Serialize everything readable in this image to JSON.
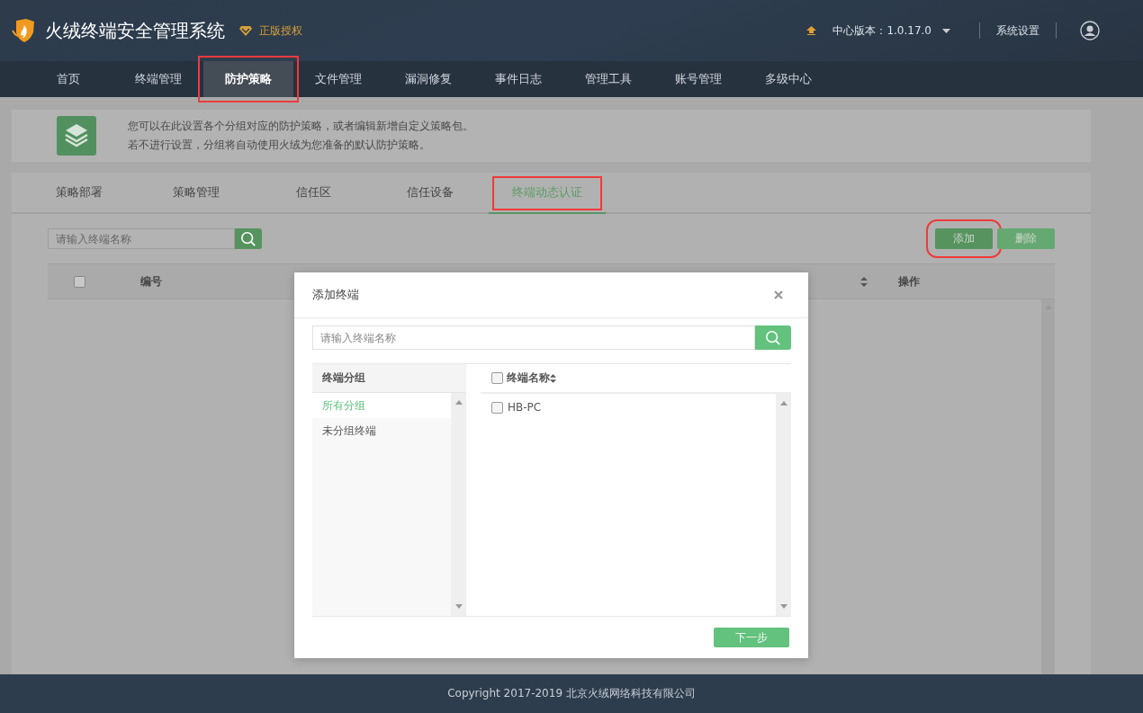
{
  "header": {
    "title": "火绒终端安全管理系统",
    "license": "正版授权",
    "version": "中心版本：1.0.17.0",
    "settings": "系统设置"
  },
  "nav": [
    {
      "label": "首页",
      "selected": false,
      "highlighted": false
    },
    {
      "label": "终端管理",
      "selected": false,
      "highlighted": false
    },
    {
      "label": "防护策略",
      "selected": true,
      "highlighted": true
    },
    {
      "label": "文件管理",
      "selected": false,
      "highlighted": false
    },
    {
      "label": "漏洞修复",
      "selected": false,
      "highlighted": false
    },
    {
      "label": "事件日志",
      "selected": false,
      "highlighted": false
    },
    {
      "label": "管理工具",
      "selected": false,
      "highlighted": false
    },
    {
      "label": "账号管理",
      "selected": false,
      "highlighted": false
    },
    {
      "label": "多级中心",
      "selected": false,
      "highlighted": false
    }
  ],
  "info": {
    "lines": [
      "您可以在此设置各个分组对应的防护策略，或者编辑新增自定义策略包。",
      "若不进行设置，分组将自动使用火绒为您准备的默认防护策略。"
    ]
  },
  "tabs": [
    {
      "label": "策略部署",
      "selected": false,
      "highlighted": false
    },
    {
      "label": "策略管理",
      "selected": false,
      "highlighted": false
    },
    {
      "label": "信任区",
      "selected": false,
      "highlighted": false
    },
    {
      "label": "信任设备",
      "selected": false,
      "highlighted": false
    },
    {
      "label": "终端动态认证",
      "selected": true,
      "highlighted": true
    }
  ],
  "toolbar": {
    "search": {
      "placeholder": "请输入终端名称"
    },
    "buttons": [
      {
        "label": "添加",
        "highlighted": true
      },
      {
        "label": "删除",
        "highlighted": false
      }
    ]
  },
  "table": {
    "select_all_checked": false,
    "columns": [
      "编号",
      "操作"
    ]
  },
  "dialog": {
    "title": "添加终端",
    "search": {
      "placeholder": "请输入终端名称"
    },
    "groups_header": "终端分组",
    "groups": [
      {
        "label": "所有分组",
        "selected": true
      },
      {
        "label": "未分组终端",
        "selected": false
      }
    ],
    "terminals_header": "终端名称",
    "select_all_checked": false,
    "terminals": [
      {
        "name": "HB-PC",
        "checked": false
      }
    ],
    "next": "下一步"
  },
  "footer": "Copyright 2017-2019 北京火绒网络科技有限公司"
}
